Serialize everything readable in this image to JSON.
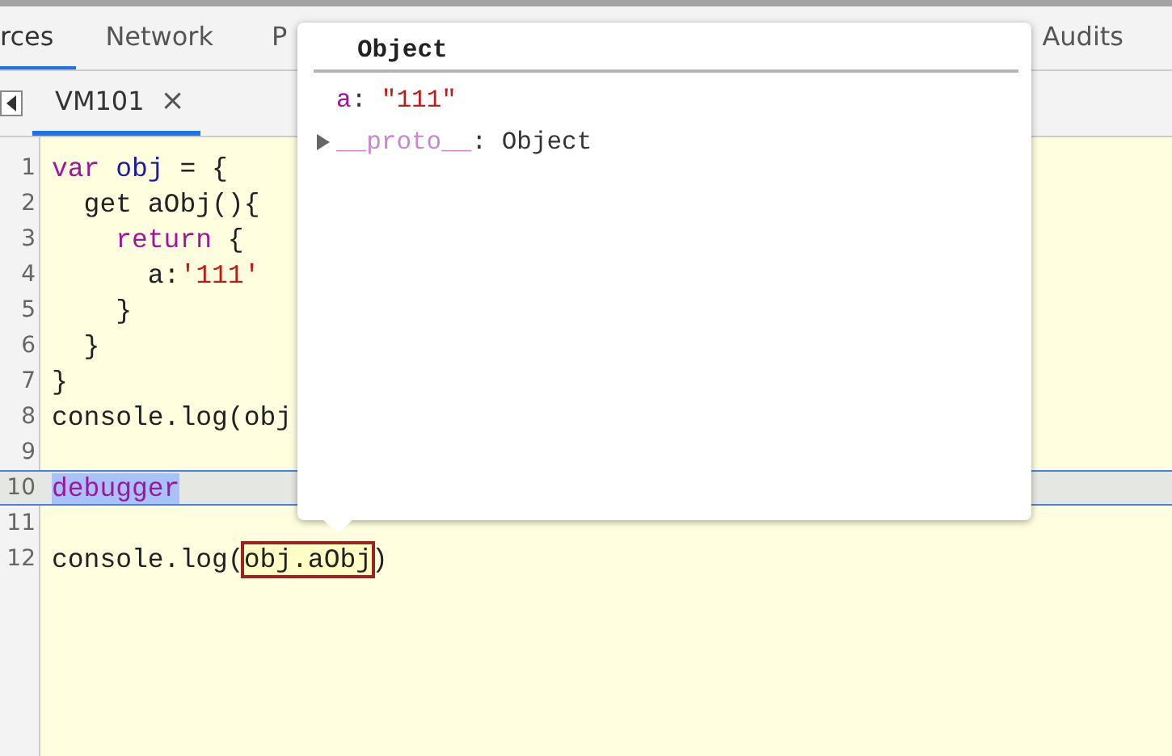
{
  "panel_tabs": [
    {
      "label": "rces",
      "selected": true
    },
    {
      "label": "Network",
      "selected": false
    },
    {
      "label": "P",
      "selected": false
    },
    {
      "label": "Audits",
      "selected": false
    }
  ],
  "file_tabs": [
    {
      "label": "VM101",
      "close": "×",
      "selected": true
    }
  ],
  "editor": {
    "lines": [
      {
        "number": "1",
        "current": false,
        "tokens": [
          {
            "kind": "keyword",
            "text": "var"
          },
          {
            "kind": "name",
            "text": " obj"
          },
          {
            "kind": "plain",
            "text": " = {"
          }
        ]
      },
      {
        "number": "2",
        "current": false,
        "tokens": [
          {
            "kind": "plain",
            "text": "  get aObj(){"
          }
        ]
      },
      {
        "number": "3",
        "current": false,
        "tokens": [
          {
            "kind": "keyword",
            "text": "    return"
          },
          {
            "kind": "plain",
            "text": " {"
          }
        ]
      },
      {
        "number": "4",
        "current": false,
        "tokens": [
          {
            "kind": "plain",
            "text": "      a:"
          },
          {
            "kind": "string",
            "text": "'111'"
          }
        ]
      },
      {
        "number": "5",
        "current": false,
        "tokens": [
          {
            "kind": "plain",
            "text": "    }"
          }
        ]
      },
      {
        "number": "6",
        "current": false,
        "tokens": [
          {
            "kind": "plain",
            "text": "  }"
          }
        ]
      },
      {
        "number": "7",
        "current": false,
        "tokens": [
          {
            "kind": "plain",
            "text": "}"
          }
        ]
      },
      {
        "number": "8",
        "current": false,
        "tokens": [
          {
            "kind": "plain",
            "text": "console.log(obj"
          }
        ]
      },
      {
        "number": "9",
        "current": false
      },
      {
        "number": "10",
        "current": true,
        "tokens": [
          {
            "kind": "selection",
            "text": "debugger"
          }
        ]
      },
      {
        "number": "11",
        "current": false
      },
      {
        "number": "12",
        "current": false,
        "tokens": [
          {
            "kind": "plain",
            "text": "console.log("
          },
          {
            "kind": "evaluated",
            "text": "obj.aObj"
          },
          {
            "kind": "plain",
            "text": ")"
          }
        ]
      }
    ]
  },
  "popover": {
    "title": "Object",
    "properties": [
      {
        "name": "a",
        "separator": ":",
        "value": "\"111\"",
        "kind": "string",
        "expandable": false
      },
      {
        "name": "__proto__",
        "separator": ":",
        "value": "Object",
        "kind": "object",
        "expandable": true
      }
    ]
  }
}
